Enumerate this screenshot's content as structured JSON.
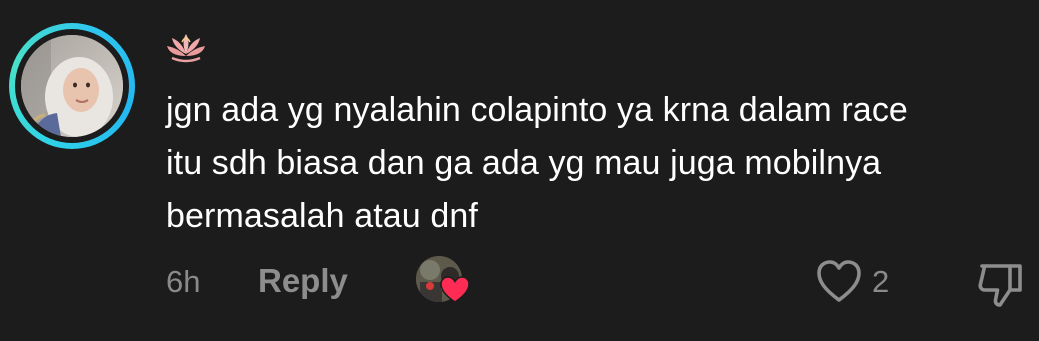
{
  "comment": {
    "text_lines": [
      "jgn ada yg nyalahin colapinto ya krna dalam race",
      "itu sdh biasa dan ga ada yg mau juga mobilnya",
      "bermasalah atau dnf"
    ],
    "timestamp": "6h",
    "reply_label": "Reply",
    "like_count": "2",
    "username_badge_icon": "lotus-icon",
    "colors": {
      "background": "#1c1c1c",
      "text": "#ffffff",
      "muted": "#8a8a8a",
      "story_ring": "#2fd3e8",
      "heart": "#fe2c55"
    }
  }
}
